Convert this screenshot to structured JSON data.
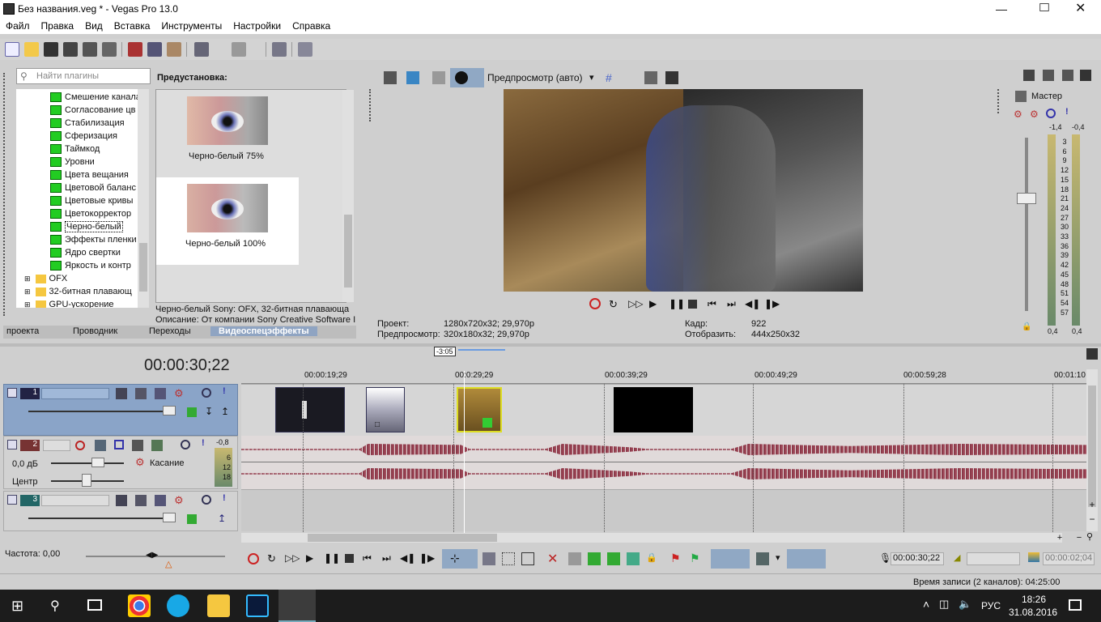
{
  "window": {
    "title": "Без названия.veg * - Vegas Pro 13.0"
  },
  "menu": [
    "Файл",
    "Правка",
    "Вид",
    "Вставка",
    "Инструменты",
    "Настройки",
    "Справка"
  ],
  "plugins": {
    "search_placeholder": "Найти плагины",
    "items": [
      "Смешение канала",
      "Согласование цв",
      "Стабилизация",
      "Сферизация",
      "Таймкод",
      "Уровни",
      "Цвета вещания",
      "Цветовой баланс",
      "Цветовые кривы",
      "Цветокорректор",
      "Черно-белый",
      "Эффекты пленки",
      "Ядро свертки",
      "Яркость и контр"
    ],
    "folders": [
      "OFX",
      "32-битная плавающ",
      "GPU-ускорение"
    ],
    "selected": "Черно-белый"
  },
  "presets": {
    "header": "Предустановка:",
    "items": [
      {
        "label": "Черно-белый 75%"
      },
      {
        "label": "Черно-белый 100%"
      }
    ],
    "info_line1": "Черно-белый Sony: OFX, 32-битная плавающа",
    "info_line2": "Описание: От компании Sony Creative Software I"
  },
  "tabs": [
    "проекта",
    "Проводник",
    "Переходы",
    "Видеоспецэффекты"
  ],
  "active_tab": "Видеоспецэффекты",
  "preview": {
    "mode": "Предпросмотр (авто)",
    "project_label": "Проект:",
    "project_value": "1280x720x32; 29,970p",
    "preview_label": "Предпросмотр:",
    "preview_value": "320x180x32; 29,970p",
    "frame_label": "Кадр:",
    "frame_value": "922",
    "display_label": "Отобразить:",
    "display_value": "444x250x32"
  },
  "master": {
    "label": "Мастер",
    "left_peak": "-1,4",
    "right_peak": "-0,4",
    "scale": [
      "3",
      "6",
      "9",
      "12",
      "15",
      "18",
      "21",
      "24",
      "27",
      "30",
      "33",
      "36",
      "39",
      "42",
      "45",
      "48",
      "51",
      "54",
      "57"
    ],
    "bottom_left": "0,4",
    "bottom_right": "0,4"
  },
  "timeline": {
    "timecode": "00:00:30;22",
    "region_label": "-3:05",
    "ruler": [
      "00:00:19;29",
      "00:0:29;29",
      "00:00:39;29",
      "00:00:49;29",
      "00:00:59;28",
      "00:01:10"
    ],
    "track1": {
      "number": "1"
    },
    "track2": {
      "number": "2",
      "volume": "0,0 дБ",
      "pan": "Центр",
      "mode": "Касание",
      "peak": "-0,8",
      "scale": [
        "6",
        "12",
        "18"
      ]
    },
    "track3": {
      "number": "3"
    },
    "rate": "Частота: 0,00",
    "cursor_time": "00:00:30;22",
    "end_time": "00:00:02;04",
    "status": "Время записи (2 каналов): 04:25:00"
  },
  "taskbar": {
    "lang": "РУС",
    "time": "18:26",
    "date": "31.08.2016"
  }
}
